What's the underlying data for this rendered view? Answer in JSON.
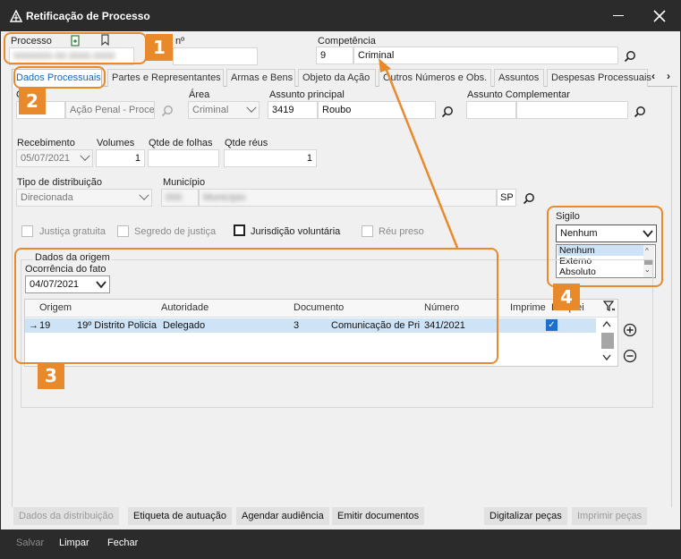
{
  "window": {
    "title": "Retificação de Processo"
  },
  "header": {
    "processo_label": "Processo",
    "processo_value": "0000000-00.0000.0000",
    "numero_label": "nº",
    "competencia_label": "Competência",
    "competencia_code": "9",
    "competencia_value": "Criminal"
  },
  "tabs": [
    {
      "label": "Dados Processuais"
    },
    {
      "label": "Partes e Representantes"
    },
    {
      "label": "Armas e Bens"
    },
    {
      "label": "Objeto da Ação"
    },
    {
      "label": "Outros Números e Obs."
    },
    {
      "label": "Assuntos"
    },
    {
      "label": "Despesas Processuais"
    }
  ],
  "dados": {
    "classe_label": "C",
    "classe_code": "",
    "classe_value": "Ação Penal - Proced",
    "area_label": "Área",
    "area_value": "Criminal",
    "assunto_label": "Assunto principal",
    "assunto_code": "3419",
    "assunto_value": "Roubo",
    "assunto_comp_label": "Assunto Complementar",
    "recebimento_label": "Recebimento",
    "recebimento_value": "05/07/2021",
    "volumes_label": "Volumes",
    "volumes_value": "1",
    "folhas_label": "Qtde de folhas",
    "folhas_value": "",
    "reus_label": "Qtde réus",
    "reus_value": "1",
    "tipo_dist_label": "Tipo de distribuição",
    "tipo_dist_value": "Direcionada",
    "municipio_label": "Município",
    "municipio_code": "000",
    "municipio_value": "Município",
    "uf_value": "SP"
  },
  "checkboxes": {
    "justica_gratuita": "Justiça gratuita",
    "segredo": "Segredo de justiça",
    "jurisdicao": "Jurisdição voluntária",
    "reu_preso": "Réu preso"
  },
  "sigilo": {
    "label": "Sigilo",
    "selected": "Nenhum",
    "options": [
      "Nenhum",
      "Externo",
      "Absoluto"
    ]
  },
  "origem": {
    "group_label": "Dados da origem",
    "ocorrencia_label": "Ocorrência do fato",
    "ocorrencia_value": "04/07/2021",
    "columns": [
      "Origem",
      "Autoridade",
      "Documento",
      "Número",
      "Imprime",
      "Bloquei"
    ],
    "rows": [
      {
        "origem": "19",
        "distrito": "19º Distrito Policia",
        "autoridade": "Delegado",
        "documento": "3",
        "tipo_doc": "Comunicação de Pri",
        "numero": "341/2021",
        "imprime": "✓"
      }
    ]
  },
  "buttons": {
    "dados_distribuicao": "Dados da distribuição",
    "etiqueta": "Etiqueta de autuação",
    "agendar": "Agendar audiência",
    "emitir": "Emitir documentos",
    "digitalizar": "Digitalizar peças",
    "imprimir": "Imprimir peças"
  },
  "footer": {
    "salvar": "Salvar",
    "limpar": "Limpar",
    "fechar": "Fechar"
  },
  "annotations": {
    "b1": "1",
    "b2": "2",
    "b3": "3",
    "b4": "4"
  },
  "colors": {
    "accent": "#e88a2c",
    "titlebar": "#2b2b2b",
    "tab_active": "#1565c0",
    "selection": "#cfe3f6"
  }
}
